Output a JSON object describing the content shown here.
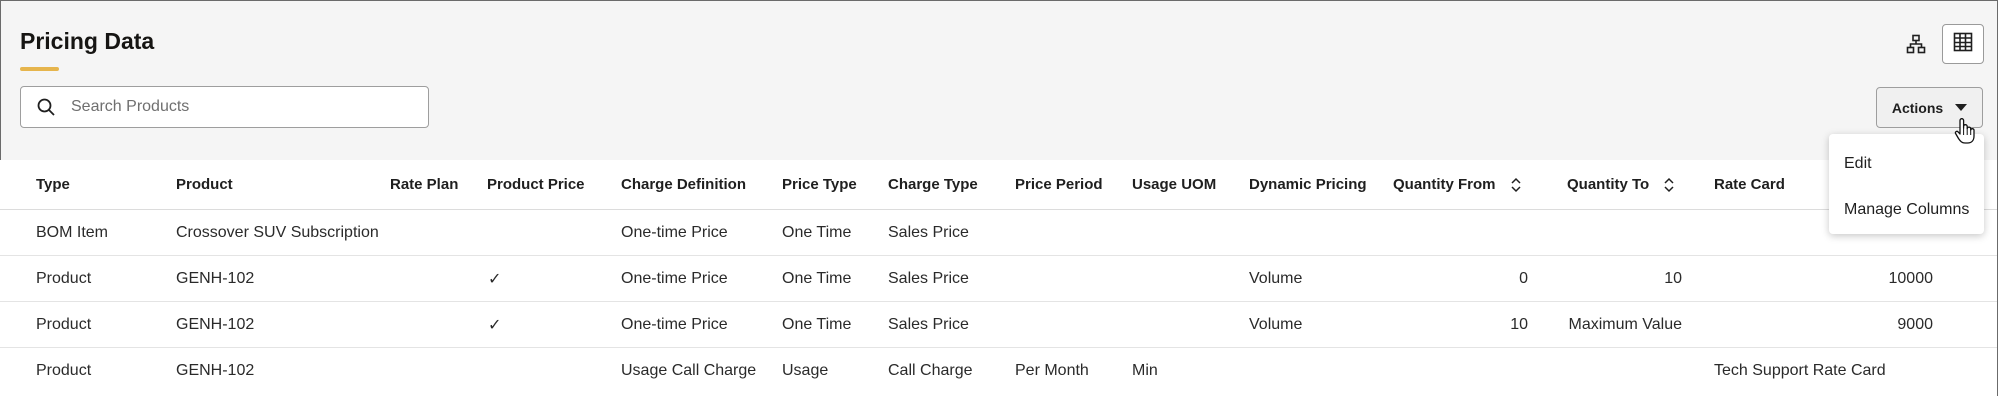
{
  "page": {
    "title": "Pricing Data"
  },
  "toolbar": {
    "hierarchy_icon": "hierarchy-icon",
    "grid_icon": "grid-icon",
    "actions_label": "Actions"
  },
  "search": {
    "placeholder": "Search Products",
    "value": ""
  },
  "actions_menu": {
    "items": [
      "Edit",
      "Manage Columns"
    ]
  },
  "table": {
    "columns": [
      "Type",
      "Product",
      "Rate Plan",
      "Product Price",
      "Charge Definition",
      "Price Type",
      "Charge Type",
      "Price Period",
      "Usage UOM",
      "Dynamic Pricing",
      "Quantity From",
      "Quantity To",
      "Rate Card",
      ""
    ],
    "rows": [
      {
        "type": "BOM Item",
        "product": "Crossover SUV Subscription",
        "rate_plan": "",
        "product_price": "",
        "charge_definition": "One-time Price",
        "price_type": "One Time",
        "charge_type": "Sales Price",
        "price_period": "",
        "usage_uom": "",
        "dynamic_pricing": "",
        "quantity_from": "",
        "quantity_to": "",
        "rate_card": "",
        "price": ""
      },
      {
        "type": "Product",
        "product": "GENH-102",
        "rate_plan": "",
        "product_price": "✓",
        "charge_definition": "One-time Price",
        "price_type": "One Time",
        "charge_type": "Sales Price",
        "price_period": "",
        "usage_uom": "",
        "dynamic_pricing": "Volume",
        "quantity_from": "0",
        "quantity_to": "10",
        "rate_card": "",
        "price": "10000"
      },
      {
        "type": "Product",
        "product": "GENH-102",
        "rate_plan": "",
        "product_price": "✓",
        "charge_definition": "One-time Price",
        "price_type": "One Time",
        "charge_type": "Sales Price",
        "price_period": "",
        "usage_uom": "",
        "dynamic_pricing": "Volume",
        "quantity_from": "10",
        "quantity_to": "Maximum Value",
        "rate_card": "",
        "price": "9000"
      },
      {
        "type": "Product",
        "product": "GENH-102",
        "rate_plan": "",
        "product_price": "",
        "charge_definition": "Usage Call Charge",
        "price_type": "Usage",
        "charge_type": "Call Charge",
        "price_period": "Per Month",
        "usage_uom": "Min",
        "dynamic_pricing": "",
        "quantity_from": "",
        "quantity_to": "",
        "rate_card": "Tech Support Rate Card",
        "price": ""
      }
    ]
  },
  "colors": {
    "accent": "#e6b54d",
    "border": "#9e9e9e",
    "background": "#f5f5f5"
  }
}
